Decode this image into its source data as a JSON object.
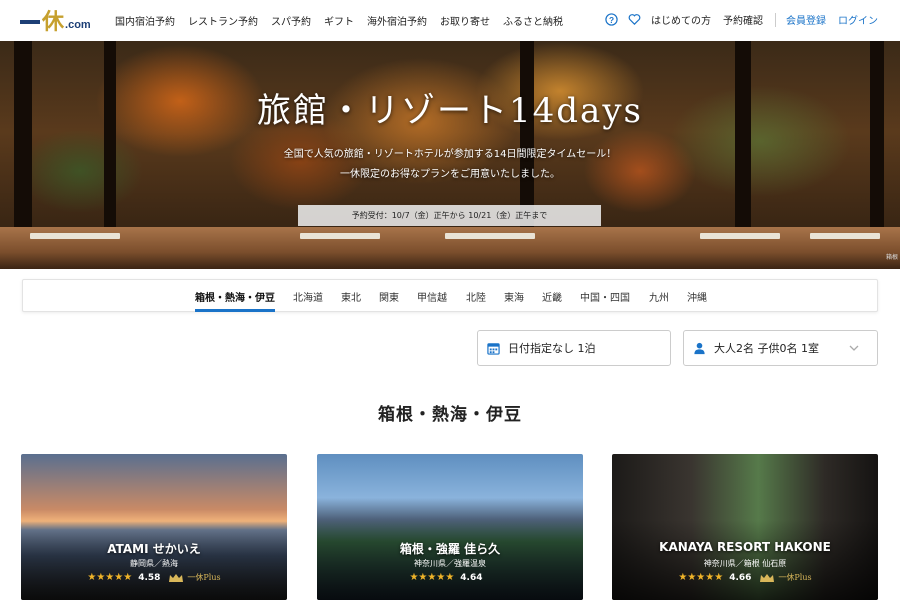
{
  "header": {
    "logo_kanji": "休",
    "logo_suffix": ".com",
    "nav": [
      "国内宿泊予約",
      "レストラン予約",
      "スパ予約",
      "ギフト",
      "海外宿泊予約",
      "お取り寄せ",
      "ふるさと納税"
    ],
    "right_links": [
      "はじめての方",
      "予約確認"
    ],
    "register": "会員登録",
    "login": "ログイン"
  },
  "hero": {
    "title": "旅館・リゾート14days",
    "subtitle_line1": "全国で人気の旅館・リゾートホテルが参加する14日間限定タイムセール！",
    "subtitle_line2": "一休限定のお得なプランをご用意いたしました。",
    "badge": "予約受付：10/7（金）正午から 10/21（金）正午まで",
    "corner_text": "箱根"
  },
  "regions": {
    "tabs": [
      "箱根・熱海・伊豆",
      "北海道",
      "東北",
      "関東",
      "甲信越",
      "北陸",
      "東海",
      "近畿",
      "中国・四国",
      "九州",
      "沖縄"
    ],
    "active": "箱根・熱海・伊豆"
  },
  "search": {
    "date_text": "日付指定なし 1泊",
    "guest_text": "大人2名 子供0名 1室"
  },
  "section": {
    "title": "箱根・熱海・伊豆"
  },
  "cards": [
    {
      "name": "ATAMI せかいえ",
      "area": "静岡県／熱海",
      "stars": "★★★★★",
      "score": "4.58",
      "badge": "一休Plus"
    },
    {
      "name": "箱根・強羅 佳ら久",
      "area": "神奈川県／強羅温泉",
      "stars": "★★★★★",
      "score": "4.64",
      "badge": ""
    },
    {
      "name": "KANAYA RESORT HAKONE",
      "area": "神奈川県／箱根 仙石原",
      "stars": "★★★★★",
      "score": "4.66",
      "badge": "一休Plus"
    }
  ],
  "colors": {
    "brand_navy": "#1d3f76",
    "brand_gold": "#c6a02e",
    "accent_blue": "#1a73c8",
    "star": "#f0b429"
  }
}
